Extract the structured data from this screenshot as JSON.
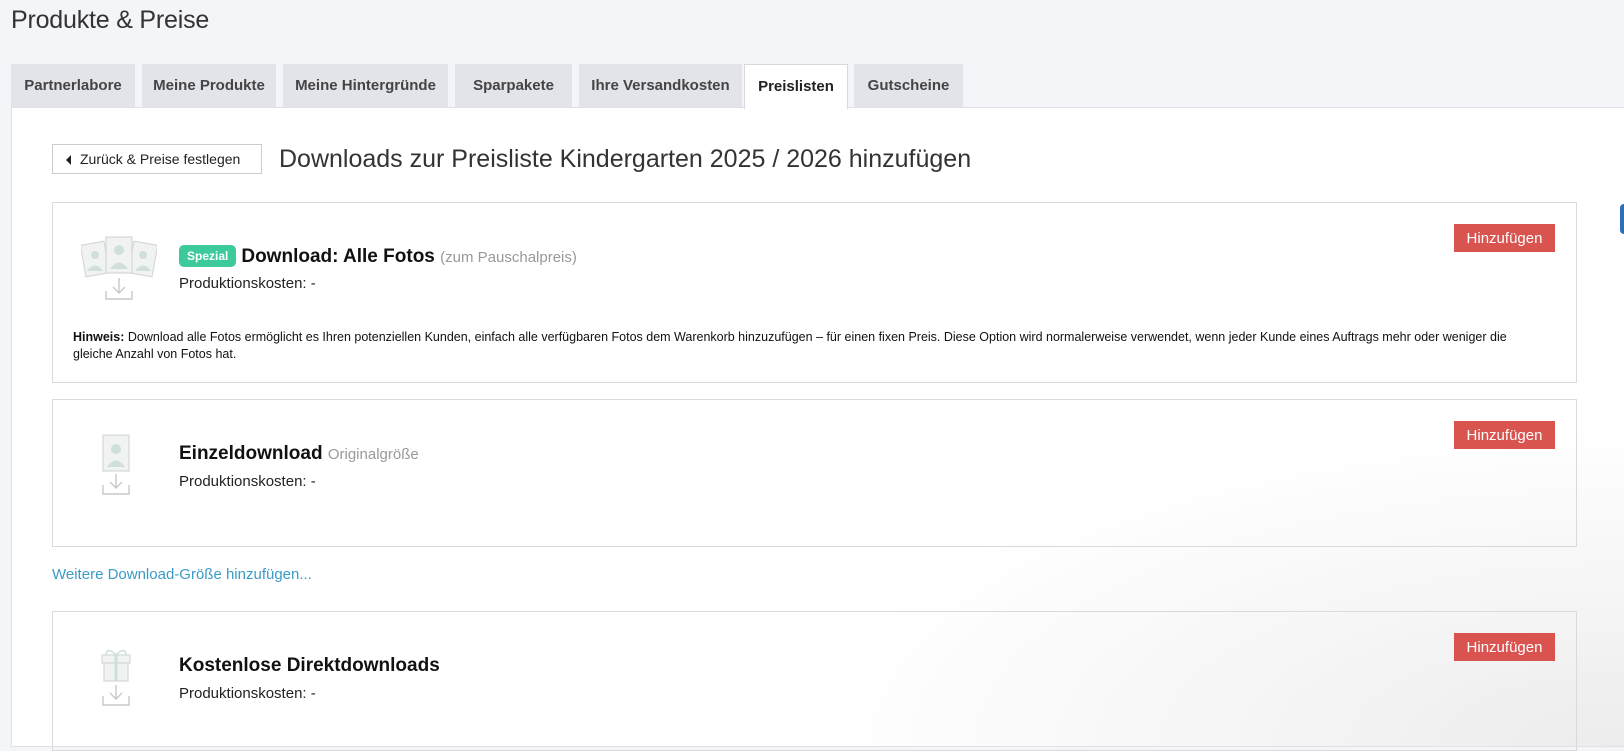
{
  "page": {
    "title": "Produkte & Preise"
  },
  "tabs": [
    {
      "label": "Partnerlabore",
      "active": false
    },
    {
      "label": "Meine Produkte",
      "active": false
    },
    {
      "label": "Meine Hintergründe",
      "active": false
    },
    {
      "label": "Sparpakete",
      "active": false
    },
    {
      "label": "Ihre Versandkosten",
      "active": false
    },
    {
      "label": "Preislisten",
      "active": true
    },
    {
      "label": "Gutscheine",
      "active": false
    }
  ],
  "back_button": {
    "label": "Zurück & Preise festlegen"
  },
  "headline": "Downloads zur Preisliste Kindergarten 2025 / 2026 hinzufügen",
  "cards": [
    {
      "icon": "all-photos-download-icon",
      "badge": "Spezial",
      "title": "Download: Alle Fotos",
      "subtitle": "(zum Pauschalpreis)",
      "production_cost": "Produktionskosten: -",
      "add_label": "Hinzufügen",
      "hint_label": "Hinweis:",
      "hint_text": "Download alle Fotos ermöglicht es Ihren potenziellen Kunden, einfach alle verfügbaren Fotos dem Warenkorb hinzuzufügen – für einen fixen Preis. Diese Option wird normalerweise verwendet, wenn jeder Kunde eines Auftrags mehr oder weniger die gleiche Anzahl von Fotos hat."
    },
    {
      "icon": "single-photo-download-icon",
      "title": "Einzeldownload",
      "subtitle": "Originalgröße",
      "production_cost": "Produktionskosten: -",
      "add_label": "Hinzufügen"
    },
    {
      "icon": "gift-download-icon",
      "title": "Kostenlose Direktdownloads",
      "production_cost": "Produktionskosten: -",
      "add_label": "Hinzufügen"
    }
  ],
  "more_link": "Weitere Download-Größe hinzufügen...",
  "colors": {
    "accent_red": "#d9534f",
    "badge_green": "#3cc99b",
    "link_blue": "#3a9bc6",
    "tab_bg": "#e2e4ea"
  }
}
